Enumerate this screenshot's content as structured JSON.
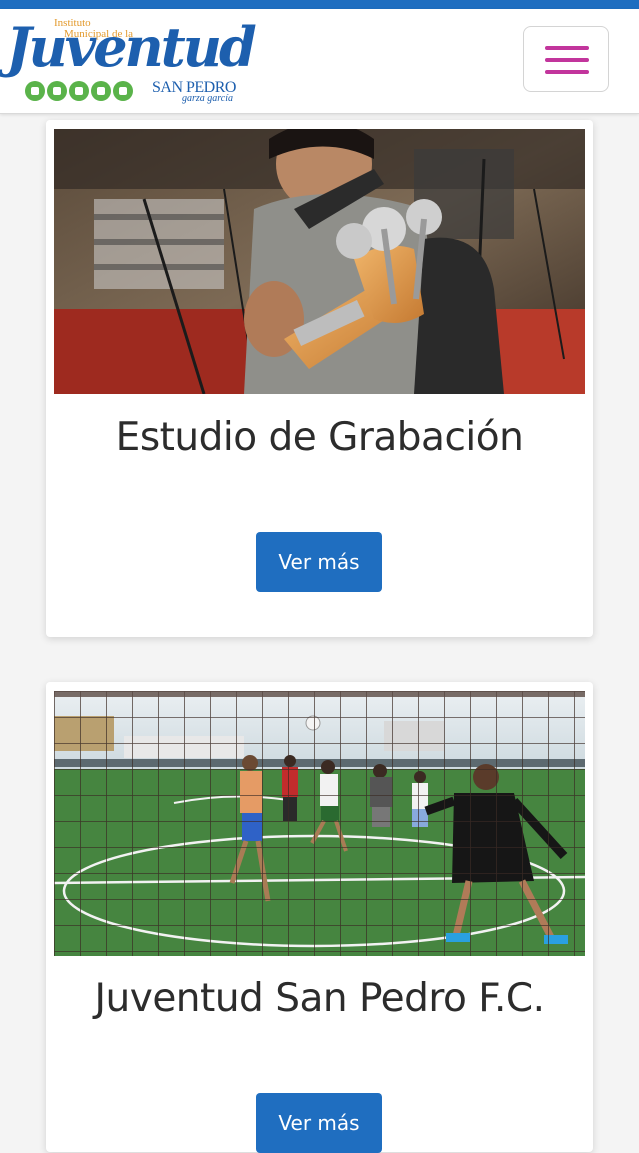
{
  "header": {
    "logo": {
      "line1": "Instituto",
      "line2": "Municipal de la",
      "name": "Juventud",
      "city": "SAN PEDRO",
      "tagline": "garza garcía",
      "icons": [
        "book-icon",
        "theater-mask-icon",
        "briefcase-icon",
        "ball-icon",
        "bottle-icon"
      ]
    },
    "menu_icon": "hamburger-icon"
  },
  "colors": {
    "accent": "#1f6ec0",
    "menu": "#c2359c",
    "logo_green": "#5ab34a",
    "logo_orange": "#e39a2d"
  },
  "cards": [
    {
      "title": "Estudio de Grabación",
      "button": "Ver más",
      "image": "guitarist-recording-studio-photo"
    },
    {
      "title": "Juventud San Pedro F.C.",
      "button": "Ver más",
      "image": "soccer-players-goal-net-photo"
    }
  ]
}
